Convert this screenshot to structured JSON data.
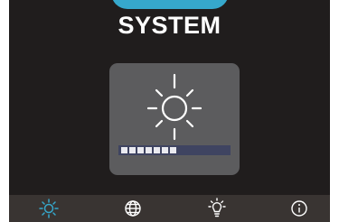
{
  "header": {
    "title": "SYSTEM"
  },
  "brightness": {
    "level_fraction": 0.52,
    "segments_total": 12,
    "segments_filled": 7
  },
  "nav": {
    "items": [
      {
        "icon": "brightness-icon",
        "active": true
      },
      {
        "icon": "globe-icon",
        "active": false
      },
      {
        "icon": "lightbulb-icon",
        "active": false
      },
      {
        "icon": "info-icon",
        "active": false
      }
    ]
  },
  "colors": {
    "background": "#201d1d",
    "accent": "#36a8cc",
    "card": "#5c5c5e",
    "nav_bar": "#393432",
    "active_icon": "#36a8cc",
    "inactive_icon": "#ffffff"
  }
}
